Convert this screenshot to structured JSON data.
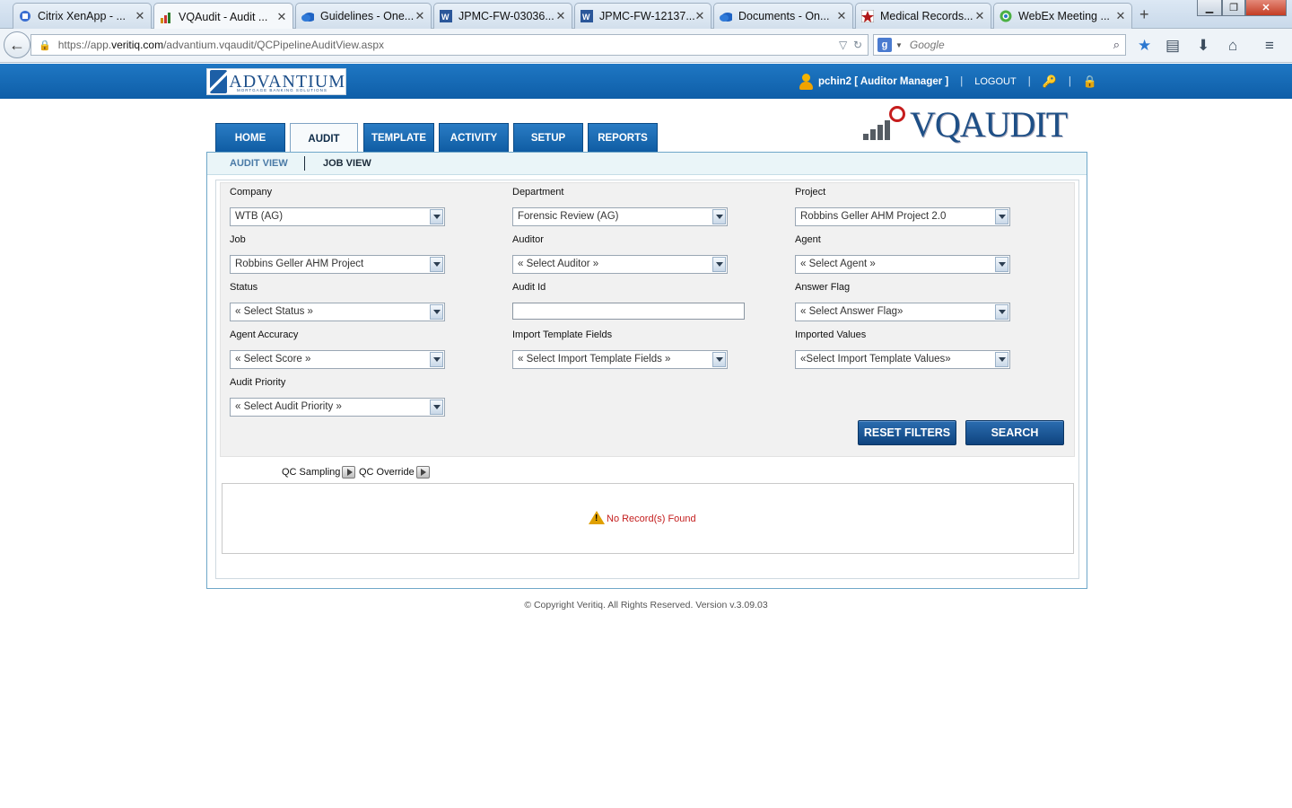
{
  "browser": {
    "tabs": [
      {
        "title": "Citrix XenApp - ...",
        "icon": "citrix-icon",
        "active": false
      },
      {
        "title": "VQAudit - Audit ...",
        "icon": "vqaudit-icon",
        "active": true
      },
      {
        "title": "Guidelines - One...",
        "icon": "onedrive-icon",
        "active": false
      },
      {
        "title": "JPMC-FW-03036...",
        "icon": "word-icon",
        "active": false
      },
      {
        "title": "JPMC-FW-12137...",
        "icon": "word-icon",
        "active": false
      },
      {
        "title": "Documents - On...",
        "icon": "onedrive-icon",
        "active": false
      },
      {
        "title": "Medical Records...",
        "icon": "star-icon",
        "active": false
      },
      {
        "title": "WebEx Meeting ...",
        "icon": "webex-icon",
        "active": false
      }
    ],
    "url_prefix": "https://app.",
    "url_host": "veritiq.com",
    "url_path": "/advantium.vqaudit/QCPipelineAuditView.aspx",
    "search_placeholder": "Google"
  },
  "header": {
    "brand": "ADVANTIUM",
    "brand_sub": "MORTGAGE BANKING SOLUTIONS",
    "user": "pchin2 [ Auditor Manager ]",
    "logout": "LOGOUT"
  },
  "nav": {
    "tabs": [
      "HOME",
      "AUDIT",
      "TEMPLATE",
      "ACTIVITY",
      "SETUP",
      "REPORTS"
    ],
    "active": "AUDIT",
    "product_logo": "VQAUDIT"
  },
  "subnav": {
    "items": [
      "AUDIT VIEW",
      "JOB VIEW"
    ],
    "active": "AUDIT VIEW"
  },
  "filters": {
    "company": {
      "label": "Company",
      "value": "WTB (AG)"
    },
    "department": {
      "label": "Department",
      "value": "Forensic Review (AG)"
    },
    "project": {
      "label": "Project",
      "value": "Robbins Geller AHM Project 2.0"
    },
    "job": {
      "label": "Job",
      "value": "Robbins Geller AHM Project"
    },
    "auditor": {
      "label": "Auditor",
      "value": "« Select Auditor »"
    },
    "agent": {
      "label": "Agent",
      "value": "« Select Agent »"
    },
    "status": {
      "label": "Status",
      "value": "« Select Status »"
    },
    "audit_id": {
      "label": "Audit Id",
      "value": ""
    },
    "answer_flag": {
      "label": "Answer Flag",
      "value": "« Select Answer Flag»"
    },
    "agent_accuracy": {
      "label": "Agent Accuracy",
      "value": "« Select Score »"
    },
    "import_template_fields": {
      "label": "Import Template Fields",
      "value": "« Select Import Template Fields »"
    },
    "imported_values": {
      "label": "Imported Values",
      "value": "«Select Import Template Values»"
    },
    "audit_priority": {
      "label": "Audit Priority",
      "value": "« Select Audit Priority »"
    }
  },
  "buttons": {
    "reset": "RESET FILTERS",
    "search": "SEARCH"
  },
  "qc": {
    "sampling": "QC Sampling",
    "override": "QC Override"
  },
  "results": {
    "empty_message": "No Record(s) Found"
  },
  "footer": "© Copyright Veritiq. All Rights Reserved. Version v.3.09.03",
  "colors": {
    "header_blue": "#1f77c3",
    "nav_tab": "#1a6cb5",
    "button": "#1a5796",
    "error_red": "#c41e1e"
  }
}
